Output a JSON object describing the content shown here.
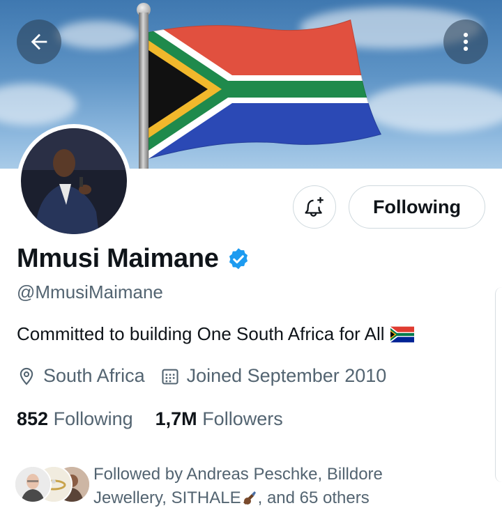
{
  "header": {
    "back_icon": "arrow-left-icon",
    "more_icon": "more-vertical-icon"
  },
  "profile": {
    "name": "Mmusi Maimane",
    "verified": true,
    "handle": "@MmusiMaimane",
    "bio": "Committed to building One South Africa for All",
    "bio_emoji": "south-africa-flag",
    "location": "South Africa",
    "joined": "Joined September 2010",
    "following_count": "852",
    "following_label": "Following",
    "followers_count": "1,7M",
    "followers_label": "Followers"
  },
  "actions": {
    "notify_icon": "bell-plus-icon",
    "follow_state_label": "Following"
  },
  "followed_by": {
    "text_line1": "Followed by Andreas Peschke, Billdore",
    "text_line2": "Jewellery, SITHALE",
    "text_line2_suffix": ", and 65 others"
  },
  "colors": {
    "verified_blue": "#1d9bf0",
    "secondary_text": "#536471",
    "primary_text": "#0f1419",
    "border": "#cfd9de"
  }
}
